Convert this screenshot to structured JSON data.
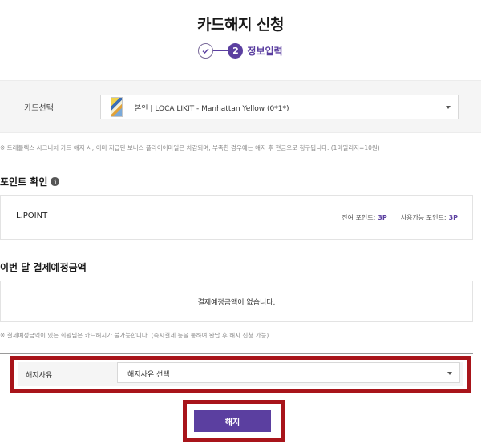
{
  "page": {
    "title": "카드해지 신청"
  },
  "stepper": {
    "current_step_number": "2",
    "current_step_label": "정보입력"
  },
  "card_select": {
    "label": "카드선택",
    "selected_value": "본인 | LOCA LIKIT - Manhattan Yellow (0*1*)"
  },
  "notices": {
    "card_notice": "※ 트레블렉스 시그니처 카드 해지 시, 이미 지급된 보너스 플라이어마일은 차감되며, 부족한 경우에는 해지 후 현금으로 청구됩니다. (1마일리지=10원)",
    "payment_notice": "※ 결제예정금액이 있는 회원님은 카드해지가 불가능합니다. (즉시결제 등을 통하여 완납 후 해지 신청 가능)"
  },
  "points": {
    "section_title": "포인트 확인",
    "program_name": "L.POINT",
    "remaining_label": "잔여 포인트:",
    "remaining_value": "3P",
    "usable_label": "사용가능 포인트:",
    "usable_value": "3P"
  },
  "payment": {
    "section_title": "이번 달 결제예정금액",
    "empty_message": "결제예정금액이 없습니다."
  },
  "reason": {
    "label": "해지사유",
    "placeholder_value": "해지사유 선택"
  },
  "actions": {
    "cancel_label": "해지"
  },
  "colors": {
    "accent": "#5b3fa0",
    "highlight_border": "#a8141a"
  },
  "icons": {
    "step_done": "check-circle-icon",
    "info": "info-icon",
    "dropdown": "chevron-down-icon"
  }
}
